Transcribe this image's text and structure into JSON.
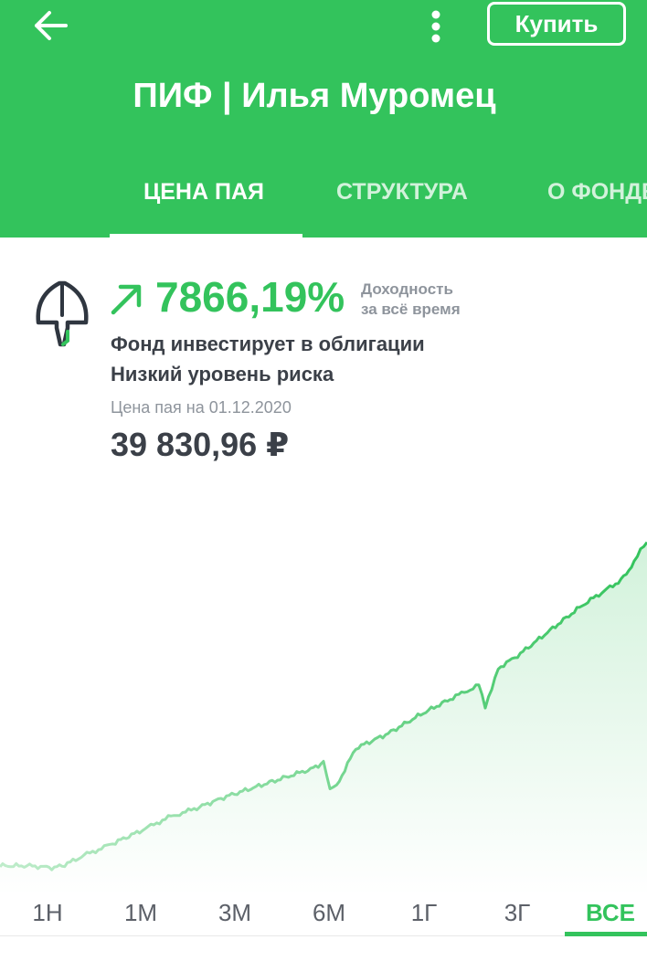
{
  "header": {
    "buy_label": "Купить",
    "title": "ПИФ | Илья Муромец",
    "tabs": [
      {
        "label": "ЦЕНА ПАЯ",
        "active": true
      },
      {
        "label": "СТРУКТУРА",
        "active": false
      },
      {
        "label": "О ФОНДЕ",
        "active": false
      }
    ],
    "back_icon": "arrow-left-icon",
    "menu_icon": "more-vertical-icon",
    "bg_color": "#33c35c"
  },
  "fund": {
    "logo_icon": "helmet-icon",
    "trend_icon": "arrow-up-right-icon",
    "yield_value": "7866,19%",
    "yield_label_1": "Доходность",
    "yield_label_2": "за всё время",
    "desc_line_1": "Фонд инвестирует в облигации",
    "desc_line_2": "Низкий уровень риска",
    "price_date": "Цена пая на 01.12.2020",
    "price_value": "39 830,96 ₽"
  },
  "chart_data": {
    "type": "area",
    "title": "",
    "xlabel": "",
    "ylabel": "",
    "line_color": "#33c35c",
    "x": [
      0,
      0.05,
      0.08,
      0.1,
      0.13,
      0.17,
      0.22,
      0.26,
      0.3,
      0.35,
      0.4,
      0.45,
      0.48,
      0.5,
      0.51,
      0.52,
      0.55,
      0.6,
      0.65,
      0.7,
      0.74,
      0.75,
      0.76,
      0.77,
      0.8,
      0.85,
      0.9,
      0.93,
      0.96,
      0.98,
      0.99,
      1.0
    ],
    "values": [
      7.0,
      7.0,
      6.5,
      7.2,
      9.5,
      12.0,
      15.5,
      18.5,
      20.5,
      23.5,
      26.0,
      28.5,
      30.0,
      31.5,
      25.0,
      26.0,
      35.0,
      38.5,
      43.0,
      47.0,
      50.0,
      44.5,
      49.0,
      54.0,
      57.0,
      63.0,
      69.0,
      72.0,
      75.0,
      79.0,
      82.0,
      84.0
    ],
    "periods": [
      "1Н",
      "1М",
      "3М",
      "6М",
      "1Г",
      "3Г",
      "ВСЕ"
    ],
    "active_period": "ВСЕ"
  }
}
